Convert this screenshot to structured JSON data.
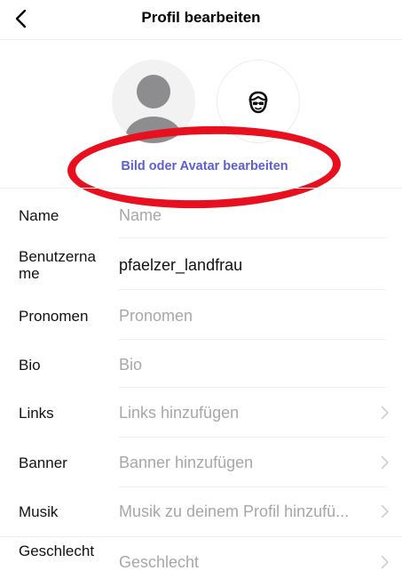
{
  "header": {
    "title": "Profil bearbeiten",
    "back_icon": "chevron-left-icon"
  },
  "profile": {
    "photo_icon": "person-placeholder-icon",
    "avatar_icon": "avatar-face-icon",
    "edit_link": "Bild oder Avatar bearbeiten",
    "highlight_color": "#e8101e",
    "link_color": "#5b5fd6"
  },
  "fields": [
    {
      "label": "Name",
      "value": "Name",
      "is_placeholder": true,
      "chevron": false
    },
    {
      "label": "Benutzername",
      "value": "pfaelzer_landfrau",
      "is_placeholder": false,
      "chevron": false
    },
    {
      "label": "Pronomen",
      "value": "Pronomen",
      "is_placeholder": true,
      "chevron": false
    },
    {
      "label": "Bio",
      "value": "Bio",
      "is_placeholder": true,
      "chevron": false
    },
    {
      "label": "Links",
      "value": "Links hinzufügen",
      "is_placeholder": true,
      "chevron": true
    },
    {
      "label": "Banner",
      "value": "Banner hinzufügen",
      "is_placeholder": true,
      "chevron": true
    },
    {
      "label": "Musik",
      "value": "Musik zu deinem Profil hinzufü...",
      "is_placeholder": true,
      "chevron": true
    },
    {
      "label": "Geschlecht",
      "value": "Geschlecht",
      "is_placeholder": true,
      "chevron": true
    }
  ]
}
